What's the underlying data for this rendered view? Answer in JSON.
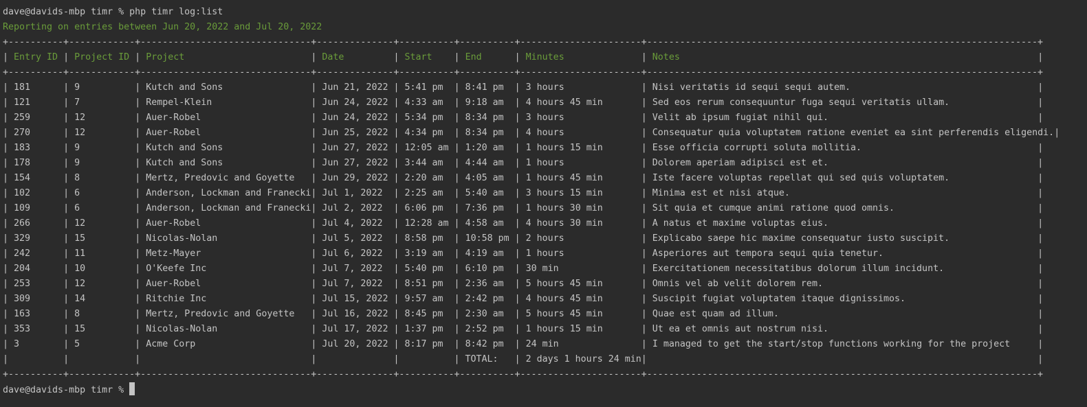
{
  "prompt": "dave@davids-mbp timr % ",
  "command": "php timr log:list",
  "report_line": "Reporting on entries between Jun 20, 2022 and Jul 20, 2022",
  "columns": [
    {
      "header": "Entry ID",
      "width": 10
    },
    {
      "header": "Project ID",
      "width": 12
    },
    {
      "header": "Project",
      "width": 31
    },
    {
      "header": "Date",
      "width": 14
    },
    {
      "header": "Start",
      "width": 10
    },
    {
      "header": "End",
      "width": 10
    },
    {
      "header": "Minutes",
      "width": 22
    },
    {
      "header": "Notes",
      "width": 71
    }
  ],
  "rows": [
    [
      "181",
      "9",
      "Kutch and Sons",
      "Jun 21, 2022",
      "5:41 pm",
      "8:41 pm",
      "3 hours",
      "Nisi veritatis id sequi sequi autem."
    ],
    [
      "121",
      "7",
      "Rempel-Klein",
      "Jun 24, 2022",
      "4:33 am",
      "9:18 am",
      "4 hours 45 min",
      "Sed eos rerum consequuntur fuga sequi veritatis ullam."
    ],
    [
      "259",
      "12",
      "Auer-Robel",
      "Jun 24, 2022",
      "5:34 pm",
      "8:34 pm",
      "3 hours",
      "Velit ab ipsum fugiat nihil qui."
    ],
    [
      "270",
      "12",
      "Auer-Robel",
      "Jun 25, 2022",
      "4:34 pm",
      "8:34 pm",
      "4 hours",
      "Consequatur quia voluptatem ratione eveniet ea sint perferendis eligendi."
    ],
    [
      "183",
      "9",
      "Kutch and Sons",
      "Jun 27, 2022",
      "12:05 am",
      "1:20 am",
      "1 hours 15 min",
      "Esse officia corrupti soluta mollitia."
    ],
    [
      "178",
      "9",
      "Kutch and Sons",
      "Jun 27, 2022",
      "3:44 am",
      "4:44 am",
      "1 hours",
      "Dolorem aperiam adipisci est et."
    ],
    [
      "154",
      "8",
      "Mertz, Predovic and Goyette",
      "Jun 29, 2022",
      "2:20 am",
      "4:05 am",
      "1 hours 45 min",
      "Iste facere voluptas repellat qui sed quis voluptatem."
    ],
    [
      "102",
      "6",
      "Anderson, Lockman and Franecki",
      "Jul 1, 2022",
      "2:25 am",
      "5:40 am",
      "3 hours 15 min",
      "Minima est et nisi atque."
    ],
    [
      "109",
      "6",
      "Anderson, Lockman and Franecki",
      "Jul 2, 2022",
      "6:06 pm",
      "7:36 pm",
      "1 hours 30 min",
      "Sit quia et cumque animi ratione quod omnis."
    ],
    [
      "266",
      "12",
      "Auer-Robel",
      "Jul 4, 2022",
      "12:28 am",
      "4:58 am",
      "4 hours 30 min",
      "A natus et maxime voluptas eius."
    ],
    [
      "329",
      "15",
      "Nicolas-Nolan",
      "Jul 5, 2022",
      "8:58 pm",
      "10:58 pm",
      "2 hours",
      "Explicabo saepe hic maxime consequatur iusto suscipit."
    ],
    [
      "242",
      "11",
      "Metz-Mayer",
      "Jul 6, 2022",
      "3:19 am",
      "4:19 am",
      "1 hours",
      "Asperiores aut tempora sequi quia tenetur."
    ],
    [
      "204",
      "10",
      "O'Keefe Inc",
      "Jul 7, 2022",
      "5:40 pm",
      "6:10 pm",
      "30 min",
      "Exercitationem necessitatibus dolorum illum incidunt."
    ],
    [
      "253",
      "12",
      "Auer-Robel",
      "Jul 7, 2022",
      "8:51 pm",
      "2:36 am",
      "5 hours 45 min",
      "Omnis vel ab velit dolorem rem."
    ],
    [
      "309",
      "14",
      "Ritchie Inc",
      "Jul 15, 2022",
      "9:57 am",
      "2:42 pm",
      "4 hours 45 min",
      "Suscipit fugiat voluptatem itaque dignissimos."
    ],
    [
      "163",
      "8",
      "Mertz, Predovic and Goyette",
      "Jul 16, 2022",
      "8:45 pm",
      "2:30 am",
      "5 hours 45 min",
      "Quae est quam ad illum."
    ],
    [
      "353",
      "15",
      "Nicolas-Nolan",
      "Jul 17, 2022",
      "1:37 pm",
      "2:52 pm",
      "1 hours 15 min",
      "Ut ea et omnis aut nostrum nisi."
    ],
    [
      "3",
      "5",
      "Acme Corp",
      "Jul 20, 2022",
      "8:17 pm",
      "8:42 pm",
      "24 min",
      "I managed to get the start/stop functions working for the project"
    ]
  ],
  "total_row": [
    "",
    "",
    "",
    "",
    "",
    "TOTAL:",
    "2 days 1 hours 24 min",
    ""
  ],
  "colors": {
    "background": "#2b2b2b",
    "text": "#c4c4c4",
    "accent_green": "#6a9c3a"
  }
}
